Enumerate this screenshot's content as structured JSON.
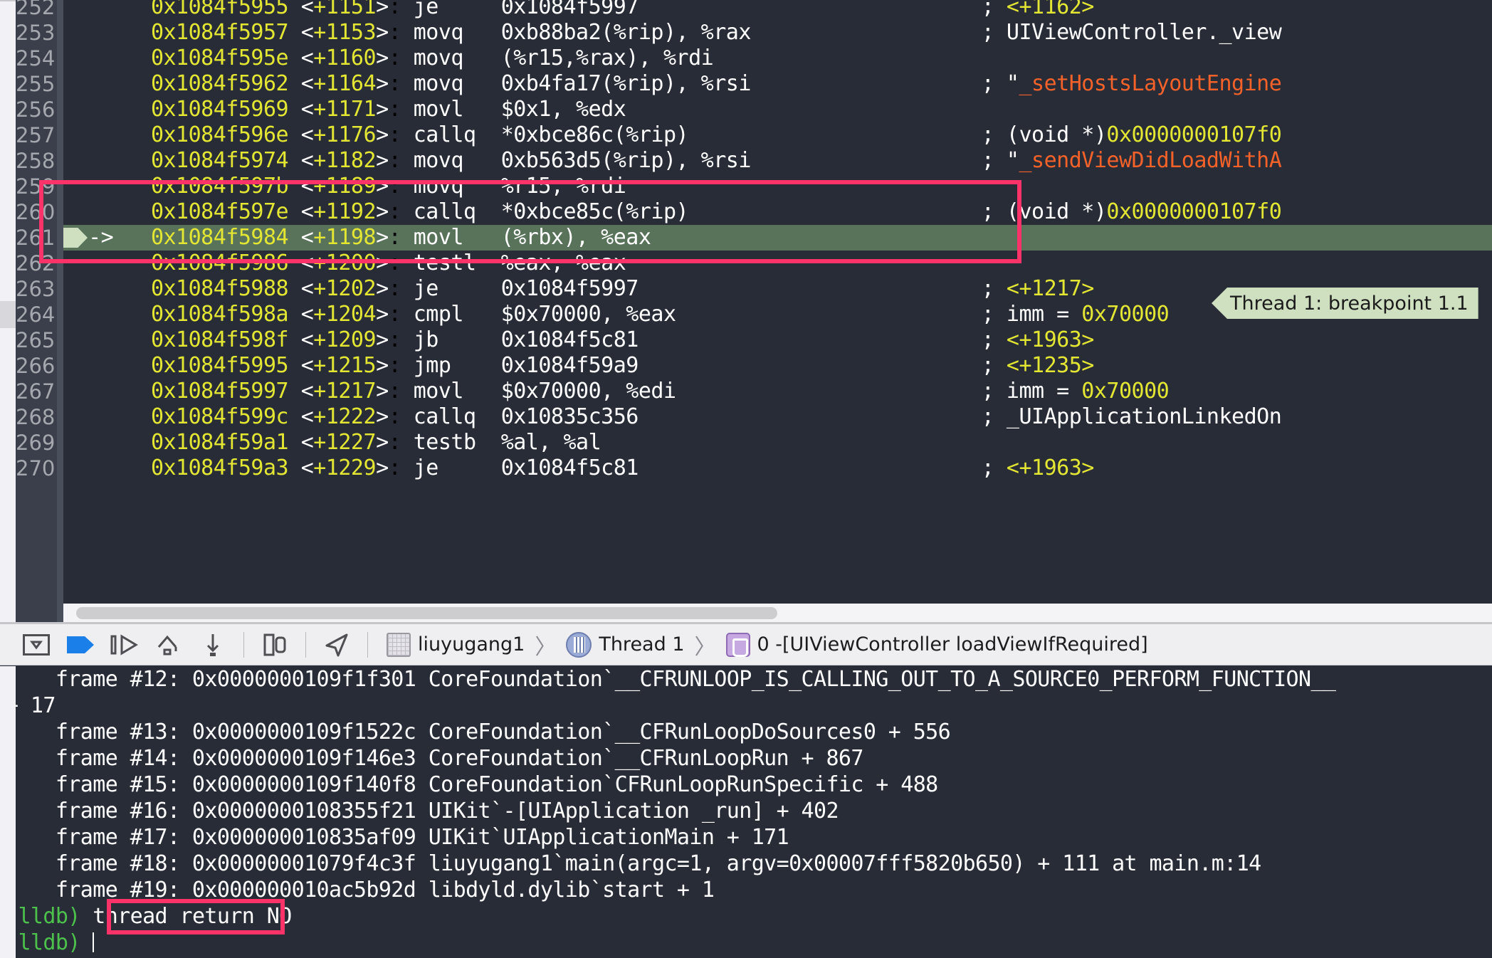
{
  "disassembly": {
    "lines": [
      {
        "num": "252",
        "addr": "0x1084f5955",
        "off": "<+1151>",
        "mn": "je",
        "ops": "0x1084f5997",
        "cmt": "; <+1162>",
        "cmt_kind": "num",
        "partial_top": true
      },
      {
        "num": "253",
        "addr": "0x1084f5957",
        "off": "<+1153>",
        "mn": "movq",
        "ops": "0xb88ba2(%rip), %rax",
        "cmt": "; UIViewController._view",
        "cmt_kind": "plain"
      },
      {
        "num": "254",
        "addr": "0x1084f595e",
        "off": "<+1160>",
        "mn": "movq",
        "ops": "(%r15,%rax), %rdi",
        "cmt": "",
        "cmt_kind": "plain"
      },
      {
        "num": "255",
        "addr": "0x1084f5962",
        "off": "<+1164>",
        "mn": "movq",
        "ops": "0xb4fa17(%rip), %rsi",
        "cmt": "; \"_setHostsLayoutEngine",
        "cmt_kind": "str"
      },
      {
        "num": "256",
        "addr": "0x1084f5969",
        "off": "<+1171>",
        "mn": "movl",
        "ops": "$0x1, %edx",
        "cmt": "",
        "cmt_kind": "plain"
      },
      {
        "num": "257",
        "addr": "0x1084f596e",
        "off": "<+1176>",
        "mn": "callq",
        "ops": "*0xbce86c(%rip)",
        "cmt": "; (void *)0x0000000107f0",
        "cmt_kind": "void"
      },
      {
        "num": "258",
        "addr": "0x1084f5974",
        "off": "<+1182>",
        "mn": "movq",
        "ops": "0xb563d5(%rip), %rsi",
        "cmt": "; \"_sendViewDidLoadWithA",
        "cmt_kind": "str"
      },
      {
        "num": "259",
        "addr": "0x1084f597b",
        "off": "<+1189>",
        "mn": "movq",
        "ops": "%r15, %rdi",
        "cmt": "",
        "cmt_kind": "plain"
      },
      {
        "num": "260",
        "addr": "0x1084f597e",
        "off": "<+1192>",
        "mn": "callq",
        "ops": "*0xbce85c(%rip)",
        "cmt": "; (void *)0x0000000107f0",
        "cmt_kind": "void"
      },
      {
        "num": "261",
        "addr": "0x1084f5984",
        "off": "<+1198>",
        "mn": "movl",
        "ops": "(%rbx), %eax",
        "cmt": "",
        "cmt_kind": "plain",
        "current": true,
        "marker": "->"
      },
      {
        "num": "262",
        "addr": "0x1084f5986",
        "off": "<+1200>",
        "mn": "testl",
        "ops": "%eax, %eax",
        "cmt": "",
        "cmt_kind": "plain"
      },
      {
        "num": "263",
        "addr": "0x1084f5988",
        "off": "<+1202>",
        "mn": "je",
        "ops": "0x1084f5997",
        "cmt": "; <+1217>",
        "cmt_kind": "num"
      },
      {
        "num": "264",
        "addr": "0x1084f598a",
        "off": "<+1204>",
        "mn": "cmpl",
        "ops": "$0x70000, %eax",
        "cmt": "; imm = 0x70000",
        "cmt_kind": "imm"
      },
      {
        "num": "265",
        "addr": "0x1084f598f",
        "off": "<+1209>",
        "mn": "jb",
        "ops": "0x1084f5c81",
        "cmt": "; <+1963>",
        "cmt_kind": "num"
      },
      {
        "num": "266",
        "addr": "0x1084f5995",
        "off": "<+1215>",
        "mn": "jmp",
        "ops": "0x1084f59a9",
        "cmt": "; <+1235>",
        "cmt_kind": "num"
      },
      {
        "num": "267",
        "addr": "0x1084f5997",
        "off": "<+1217>",
        "mn": "movl",
        "ops": "$0x70000, %edi",
        "cmt": "; imm = 0x70000",
        "cmt_kind": "imm"
      },
      {
        "num": "268",
        "addr": "0x1084f599c",
        "off": "<+1222>",
        "mn": "callq",
        "ops": "0x10835c356",
        "cmt": "; _UIApplicationLinkedOn",
        "cmt_kind": "plain"
      },
      {
        "num": "269",
        "addr": "0x1084f59a1",
        "off": "<+1227>",
        "mn": "testb",
        "ops": "%al, %al",
        "cmt": "",
        "cmt_kind": "plain"
      },
      {
        "num": "270",
        "addr": "0x1084f59a3",
        "off": "<+1229>",
        "mn": "je",
        "ops": "0x1084f5c81",
        "cmt": "; <+1963>",
        "cmt_kind": "num",
        "partial_bottom": true
      }
    ],
    "breakpoint_balloon": "Thread 1: breakpoint 1.1"
  },
  "debug_toolbar": {
    "buttons": [
      {
        "name": "hide-debug-area-button",
        "icon": "panel-toggle-icon"
      },
      {
        "name": "continue-button",
        "icon": "continue-icon"
      },
      {
        "name": "step-over-button",
        "icon": "step-over-icon"
      },
      {
        "name": "step-into-button",
        "icon": "step-into-icon"
      },
      {
        "name": "step-out-button",
        "icon": "step-out-icon"
      },
      {
        "name": "debug-view-hierarchy-button",
        "icon": "view-hierarchy-icon"
      },
      {
        "name": "simulate-location-button",
        "icon": "location-arrow-icon"
      }
    ],
    "breadcrumb": [
      {
        "label": "liuyugang1",
        "icon": "process-icon"
      },
      {
        "label": "Thread 1",
        "icon": "thread-icon"
      },
      {
        "label": "0 -[UIViewController loadViewIfRequired]",
        "icon": "frame-icon"
      }
    ],
    "separator": "〉"
  },
  "console": {
    "lines": [
      {
        "text": "    frame #12: 0x0000000109f1f301 CoreFoundation`__CFRUNLOOP_IS_CALLING_OUT_TO_A_SOURCE0_PERFORM_FUNCTION__"
      },
      {
        "text": "+ 17"
      },
      {
        "text": "    frame #13: 0x0000000109f1522c CoreFoundation`__CFRunLoopDoSources0 + 556"
      },
      {
        "text": "    frame #14: 0x0000000109f146e3 CoreFoundation`__CFRunLoopRun + 867"
      },
      {
        "text": "    frame #15: 0x0000000109f140f8 CoreFoundation`CFRunLoopRunSpecific + 488"
      },
      {
        "text": "    frame #16: 0x0000000108355f21 UIKit`-[UIApplication _run] + 402"
      },
      {
        "text": "    frame #17: 0x000000010835af09 UIKit`UIApplicationMain + 171"
      },
      {
        "text": "    frame #18: 0x00000001079f4c3f liuyugang1`main(argc=1, argv=0x00007fff5820b650) + 111 at main.m:14"
      },
      {
        "text": "    frame #19: 0x000000010ac5b92d libdyld.dylib`start + 1"
      }
    ],
    "prompt": "(lldb)",
    "command": "thread return NO",
    "prompt2": "(lldb)"
  },
  "colors": {
    "editor_bg": "#282c37",
    "gutter_bg": "#3a3f4b",
    "current_line": "#58735a",
    "address": "#e3e632",
    "string": "#f4622a",
    "annotation": "#fb3368",
    "balloon": "#cfe0c1",
    "prompt_green": "#4cc14c",
    "toolbar_bg": "#efeef1",
    "continue_blue": "#1a7fe8"
  }
}
